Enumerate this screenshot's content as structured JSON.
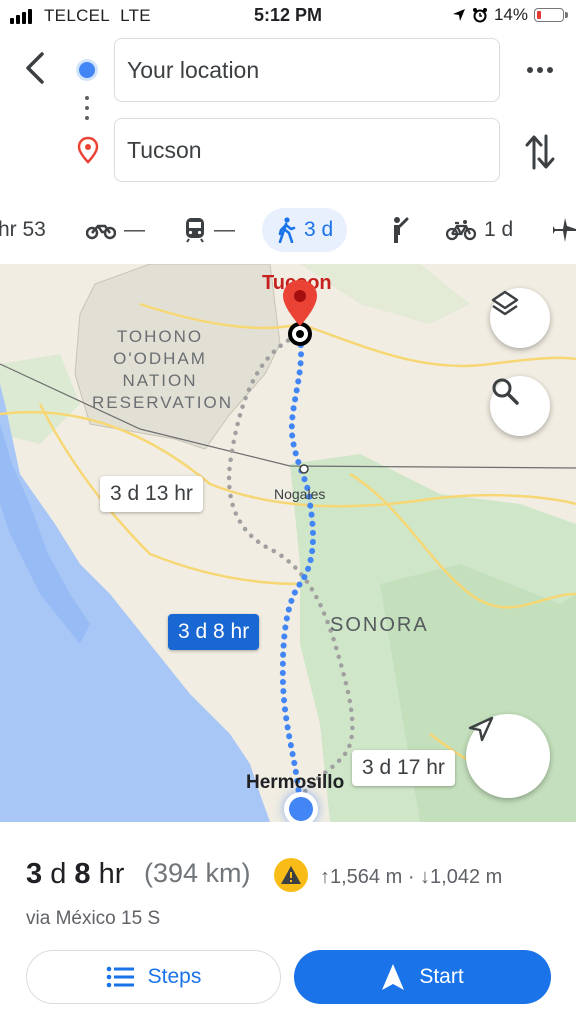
{
  "status": {
    "carrier": "TELCEL",
    "network": "LTE",
    "time": "5:12 PM",
    "battery": "14%"
  },
  "directions": {
    "origin": "Your location",
    "destination": "Tucson"
  },
  "modes": [
    {
      "name": "driving",
      "label": "hr 53"
    },
    {
      "name": "motorcycle",
      "label": "—"
    },
    {
      "name": "transit",
      "label": "—"
    },
    {
      "name": "walking",
      "label": "3 d",
      "active": true
    },
    {
      "name": "ride-hail",
      "label": ""
    },
    {
      "name": "cycling",
      "label": "1 d"
    },
    {
      "name": "flight",
      "label": ""
    }
  ],
  "map": {
    "labels": {
      "tucson": "Tucson",
      "reservation": "TOHONO\nO'ODHAM\nNATION\nRESERVATION",
      "nogales": "Nogales",
      "sonora": "SONORA",
      "hermosillo": "Hermosillo"
    },
    "routes": [
      {
        "label": "3 d 13 hr",
        "selected": false
      },
      {
        "label": "3 d 8 hr",
        "selected": true
      },
      {
        "label": "3 d 17 hr",
        "selected": false
      }
    ]
  },
  "summary": {
    "duration_num1": "3",
    "duration_unit1": "d",
    "duration_num2": "8",
    "duration_unit2": "hr",
    "distance": "(394 km)",
    "ascent": "1,564 m",
    "descent": "1,042 m",
    "via": "via México 15 S"
  },
  "actions": {
    "steps": "Steps",
    "start": "Start"
  },
  "colors": {
    "accent": "#1a73e8",
    "route": "#4285f4",
    "alt_route": "#a0a0a0",
    "pin": "#ea4335"
  }
}
